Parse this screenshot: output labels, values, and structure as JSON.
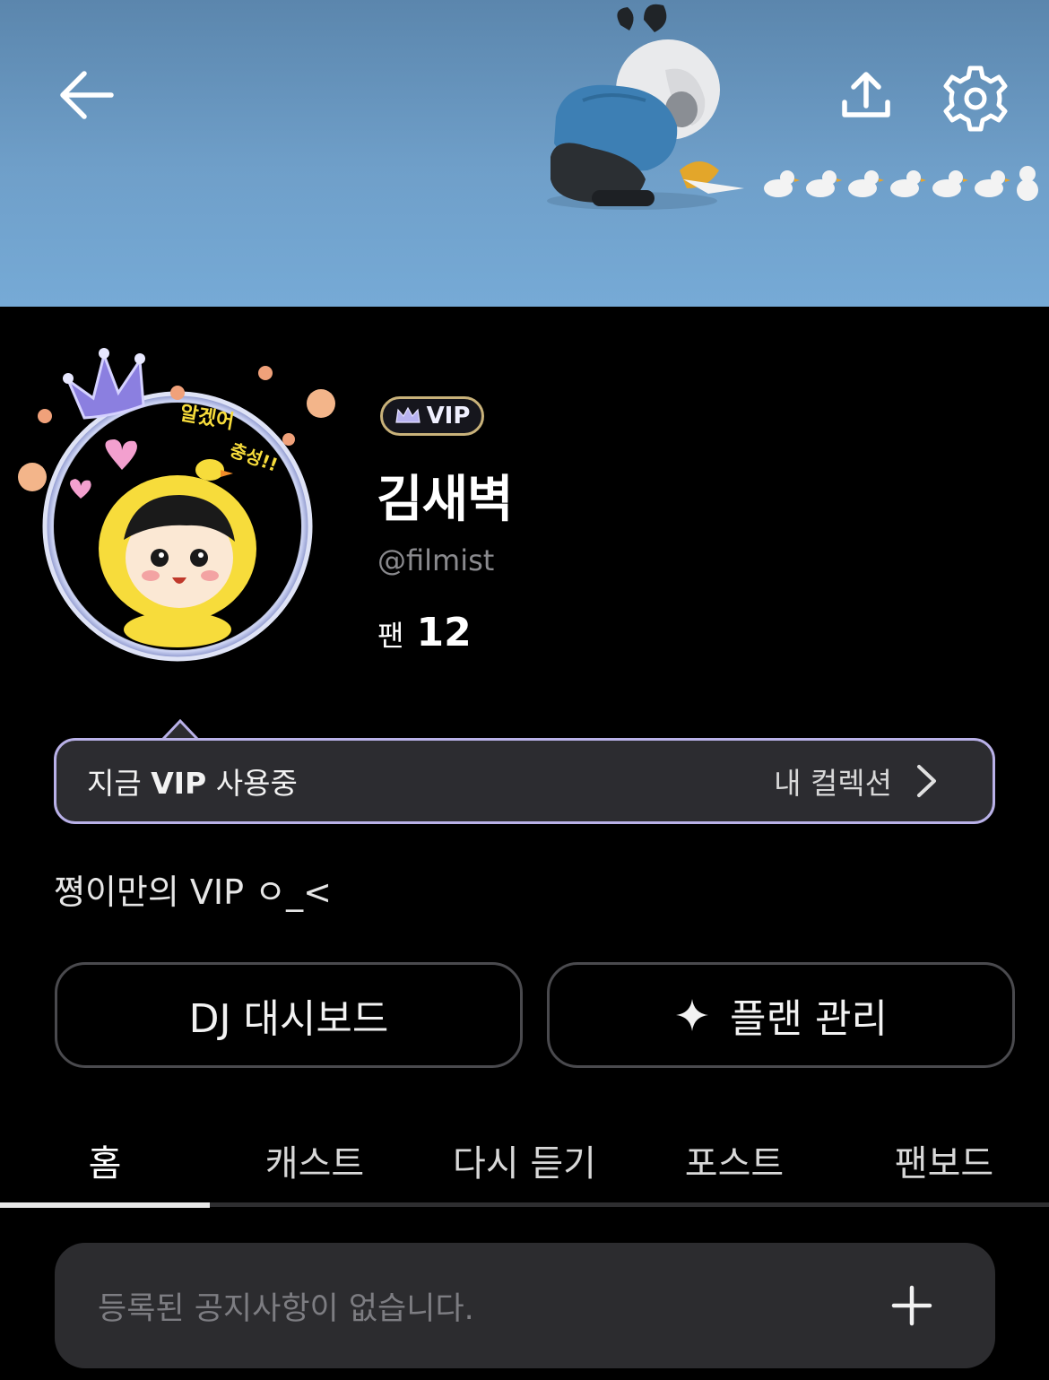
{
  "header": {
    "back_icon": "arrow-left-icon",
    "share_icon": "upload-icon",
    "settings_icon": "gear-icon"
  },
  "profile": {
    "badge_label": "VIP",
    "name": "김새벽",
    "handle": "@filmist",
    "fans_label": "팬",
    "fans_count": "12",
    "avatar_text_line1": "알겠어 ",
    "avatar_text_line2": "충성!!"
  },
  "vip_bar": {
    "status_prefix": "지금 ",
    "status_bold": "VIP",
    "status_suffix": " 사용중",
    "collection_label": "내 컬렉션"
  },
  "bio": "쪙이만의 VIP ㅇ_<",
  "actions": {
    "dj_dashboard": "DJ 대시보드",
    "plan_manage": "플랜 관리"
  },
  "tabs": [
    {
      "label": "홈",
      "active": true
    },
    {
      "label": "캐스트",
      "active": false
    },
    {
      "label": "다시 듣기",
      "active": false
    },
    {
      "label": "포스트",
      "active": false
    },
    {
      "label": "팬보드",
      "active": false
    }
  ],
  "notice": {
    "empty_text": "등록된 공지사항이 없습니다."
  },
  "colors": {
    "background": "#000000",
    "banner": "#6f9fc9",
    "vip_border": "#b9b1e8",
    "card": "#2c2c2f"
  }
}
